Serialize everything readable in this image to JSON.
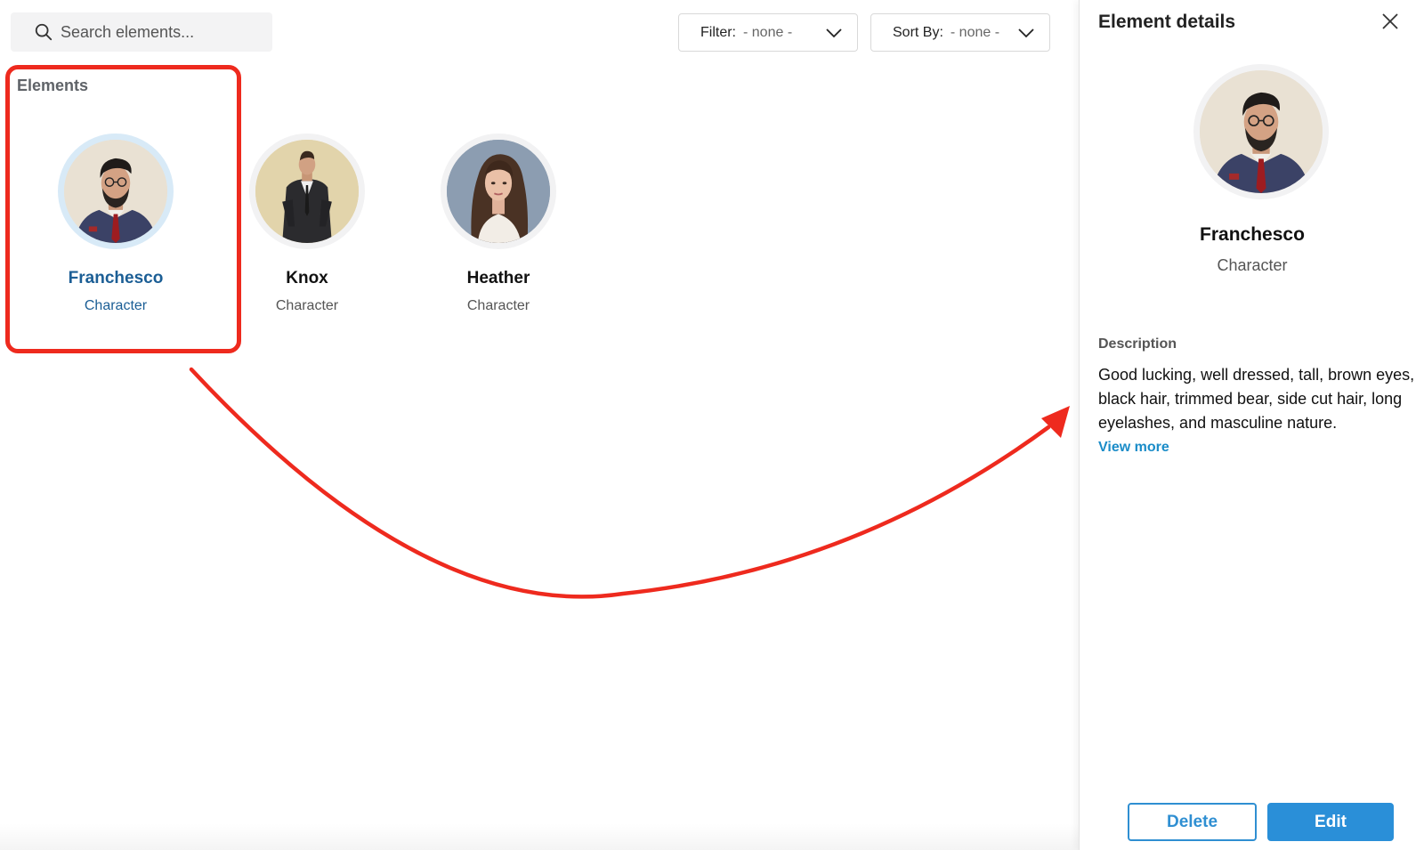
{
  "search": {
    "placeholder": "Search elements..."
  },
  "filter": {
    "label": "Filter:",
    "value": "- none -"
  },
  "sort": {
    "label": "Sort By:",
    "value": "- none -"
  },
  "elements": {
    "section_label": "Elements",
    "items": [
      {
        "name": "Franchesco",
        "type": "Character",
        "selected": true
      },
      {
        "name": "Knox",
        "type": "Character",
        "selected": false
      },
      {
        "name": "Heather",
        "type": "Character",
        "selected": false
      }
    ]
  },
  "details": {
    "title": "Element details",
    "name": "Franchesco",
    "type": "Character",
    "description_label": "Description",
    "description": "Good lucking, well dressed, tall, brown eyes, black hair, trimmed bear, side cut hair, long eyelashes, and masculine nature.",
    "view_more": "View more",
    "delete_label": "Delete",
    "edit_label": "Edit"
  },
  "colors": {
    "accent": "#2a8fd8",
    "selected_text": "#1b5e95",
    "highlight": "#ee2a1e"
  }
}
